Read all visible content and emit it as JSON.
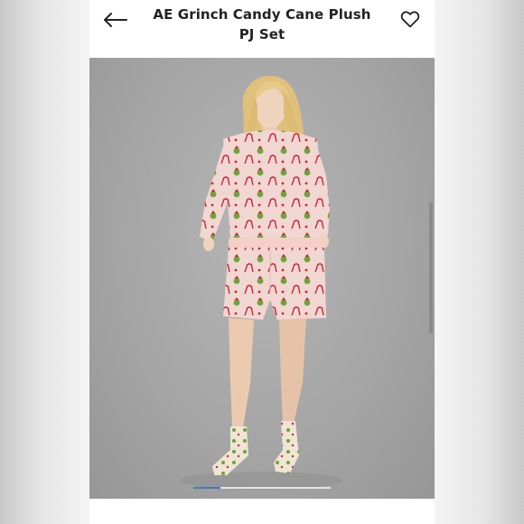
{
  "header": {
    "title": "AE Grinch Candy Cane Plush PJ Set",
    "back_icon": "arrow-left-icon",
    "favorite_icon": "heart-outline-icon"
  },
  "gallery": {
    "progress": 0.2
  },
  "colors": {
    "accent": "#4a78b8",
    "pajama": "#f0d6d0",
    "grinch": "#6ea33a",
    "candy": "#c9243a"
  }
}
